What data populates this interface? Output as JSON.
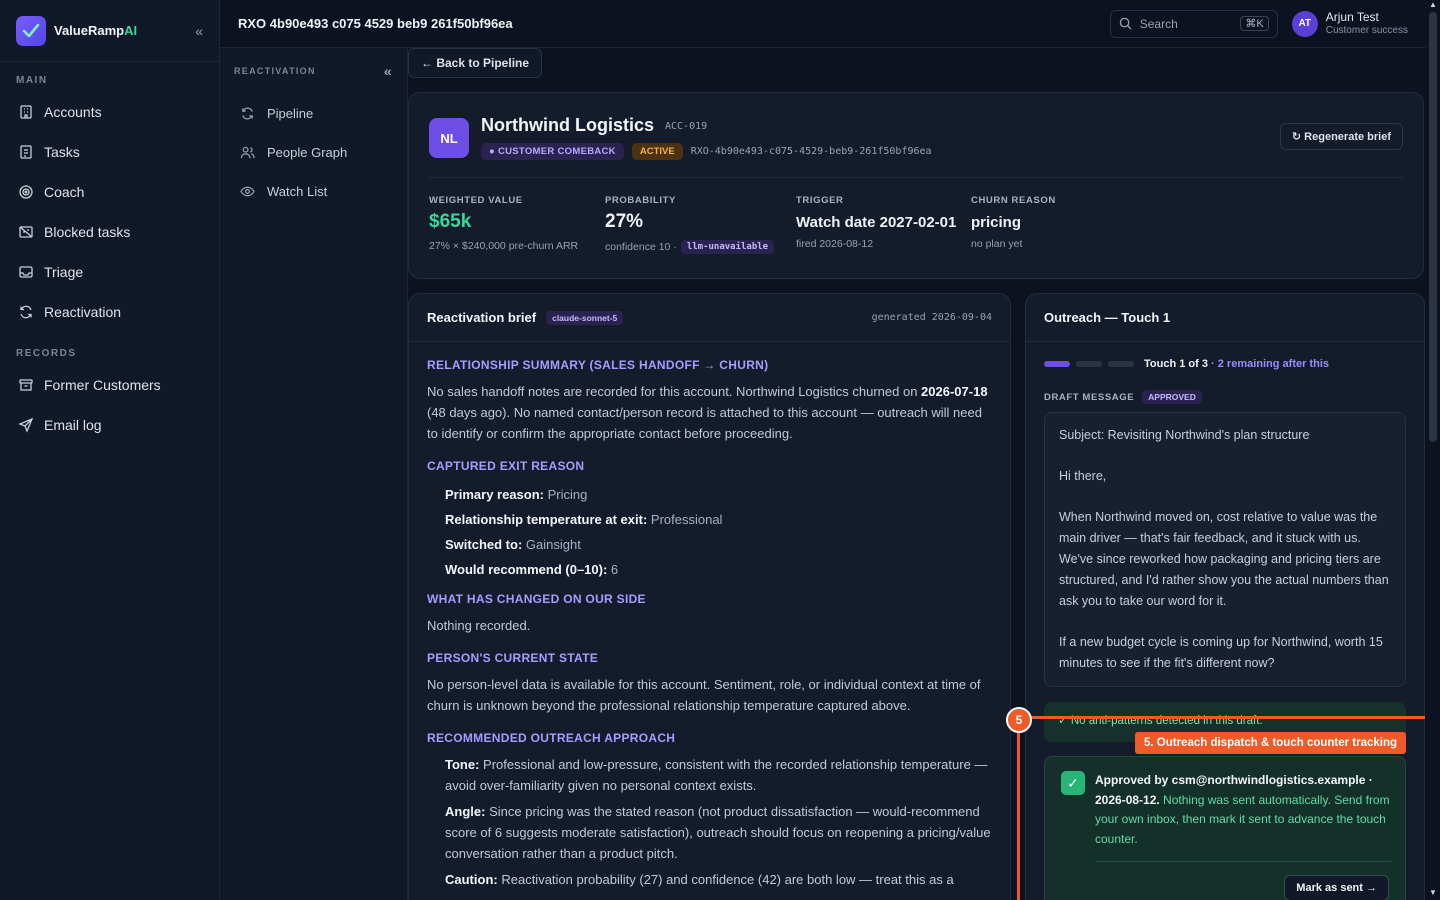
{
  "brand": {
    "name": "ValueRamp",
    "suffix": "AI",
    "collapse_icon": "double-chevron-left-icon"
  },
  "sidebar": {
    "sections": [
      {
        "label": "MAIN",
        "items": [
          {
            "label": "Accounts",
            "icon": "building-icon"
          },
          {
            "label": "Tasks",
            "icon": "checklist-icon"
          },
          {
            "label": "Coach",
            "icon": "target-icon"
          },
          {
            "label": "Blocked tasks",
            "icon": "blocked-icon"
          },
          {
            "label": "Triage",
            "icon": "inbox-icon"
          },
          {
            "label": "Reactivation",
            "icon": "refresh-icon"
          }
        ]
      },
      {
        "label": "RECORDS",
        "items": [
          {
            "label": "Former Customers",
            "icon": "archive-icon"
          },
          {
            "label": "Email log",
            "icon": "send-icon"
          }
        ]
      }
    ]
  },
  "subnav": {
    "heading": "REACTIVATION",
    "items": [
      {
        "label": "Pipeline",
        "icon": "refresh-icon"
      },
      {
        "label": "People Graph",
        "icon": "people-icon"
      },
      {
        "label": "Watch List",
        "icon": "eye-icon"
      }
    ]
  },
  "topbar": {
    "title": "RXO 4b90e493 c075 4529 beb9 261f50bf96ea",
    "search_label": "Search",
    "search_shortcut": "⌘K",
    "user_initials": "AT",
    "user_name": "Arjun Test",
    "user_role": "Customer success"
  },
  "main": {
    "back_label": "← Back to Pipeline",
    "account": {
      "initials": "NL",
      "name": "Northwind Logistics",
      "id": "ACC-019",
      "tag_comeback": "● CUSTOMER COMEBACK",
      "tag_status": "ACTIVE",
      "rxo": "RXO-4b90e493-c075-4529-beb9-261f50bf96ea",
      "regenerate_label": "↻ Regenerate brief",
      "metrics": {
        "weighted_label": "WEIGHTED VALUE",
        "weighted_value": "$65k",
        "weighted_sub": "27% × $240,000 pre-churn ARR",
        "prob_label": "PROBABILITY",
        "prob_value": "27%",
        "prob_sub": "confidence 10 ·",
        "prob_pill": "llm-unavailable",
        "trigger_label": "TRIGGER",
        "trigger_value": "Watch date 2027-02-01",
        "trigger_sub": "fired 2026-08-12",
        "churn_label": "CHURN REASON",
        "churn_value": "pricing",
        "churn_sub": "no plan yet"
      }
    },
    "brief": {
      "title": "Reactivation brief",
      "model": "claude-sonnet-5",
      "generated": "generated 2026-09-04",
      "s1_title": "RELATIONSHIP SUMMARY (SALES HANDOFF → CHURN)",
      "s1_a": "No sales handoff notes are recorded for this account. Northwind Logistics churned on ",
      "s1_date": "2026-07-18",
      "s1_b": " (48 days ago). No named contact/person record is attached to this account — outreach will need to identify or confirm the appropriate contact before proceeding.",
      "s2_title": "CAPTURED EXIT REASON",
      "s2_k1": "Primary reason:",
      "s2_v1": "Pricing",
      "s2_k2": "Relationship temperature at exit:",
      "s2_v2": "Professional",
      "s2_k3": "Switched to:",
      "s2_v3": "Gainsight",
      "s2_k4": "Would recommend (0–10):",
      "s2_v4": "6",
      "s3_title": "WHAT HAS CHANGED ON OUR SIDE",
      "s3_text": "Nothing recorded.",
      "s4_title": "PERSON'S CURRENT STATE",
      "s4_text": "No person-level data is available for this account. Sentiment, role, or individual context at time of churn is unknown beyond the professional relationship temperature captured above.",
      "s5_title": "RECOMMENDED OUTREACH APPROACH",
      "s5_k1": "Tone:",
      "s5_v1": "Professional and low-pressure, consistent with the recorded relationship temperature — avoid over-familiarity given no personal context exists.",
      "s5_k2": "Angle:",
      "s5_v2": "Since pricing was the stated reason (not product dissatisfaction — would-recommend score of 6 suggests moderate satisfaction), outreach should focus on reopening a pricing/value conversation rather than a product pitch.",
      "s5_k3": "Caution:",
      "s5_v3": "Reactivation probability (27) and confidence (42) are both low — treat this as a"
    },
    "outreach": {
      "title": "Outreach — Touch 1",
      "touch": "Touch 1 of 3",
      "remaining": " · 2 remaining after this",
      "draft_label": "DRAFT MESSAGE",
      "draft_status": "APPROVED",
      "subject": "Subject: Revisiting Northwind's plan structure",
      "greeting": "Hi there,",
      "body1": "When Northwind moved on, cost relative to value was the main driver — that's fair feedback, and it stuck with us. We've since reworked how packaging and pricing tiers are structured, and I'd rather show you the actual numbers than ask you to take our word for it.",
      "body2": "If a new budget cycle is coming up for Northwind, worth 15 minutes to see if the fit's different now?",
      "antipattern": "✓ No anti-patterns detected in this draft.",
      "approved_by": "Approved by csm@northwindlogistics.example · 2026-08-12.",
      "approved_note": " Nothing was sent automatically. Send from your own inbox, then mark it sent to advance the touch counter.",
      "mark_sent": "Mark as sent →"
    }
  },
  "annotation": {
    "number": "5",
    "label": "5. Outreach dispatch & touch counter tracking",
    "color": "#f05a28"
  }
}
